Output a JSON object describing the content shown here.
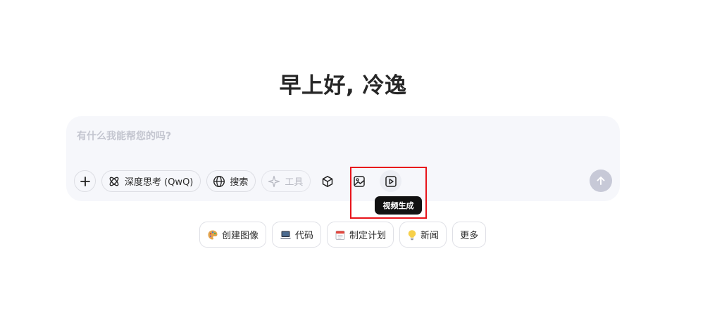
{
  "greeting": "早上好, 冷逸",
  "composer": {
    "placeholder": "有什么我能帮您的吗?",
    "value": ""
  },
  "toolbar": {
    "deep_think_label": "深度思考 (QwQ)",
    "search_label": "搜索",
    "tools_label": "工具"
  },
  "tooltip": "视频生成",
  "suggestions": [
    {
      "label": "创建图像",
      "icon": "palette-icon"
    },
    {
      "label": "代码",
      "icon": "laptop-icon"
    },
    {
      "label": "制定计划",
      "icon": "calendar-icon"
    },
    {
      "label": "新闻",
      "icon": "lightbulb-icon"
    },
    {
      "label": "更多",
      "icon": ""
    }
  ],
  "colors": {
    "composer_bg": "#f6f7fb",
    "send_button": "#c7c9d7",
    "highlight": "#e8141b"
  }
}
